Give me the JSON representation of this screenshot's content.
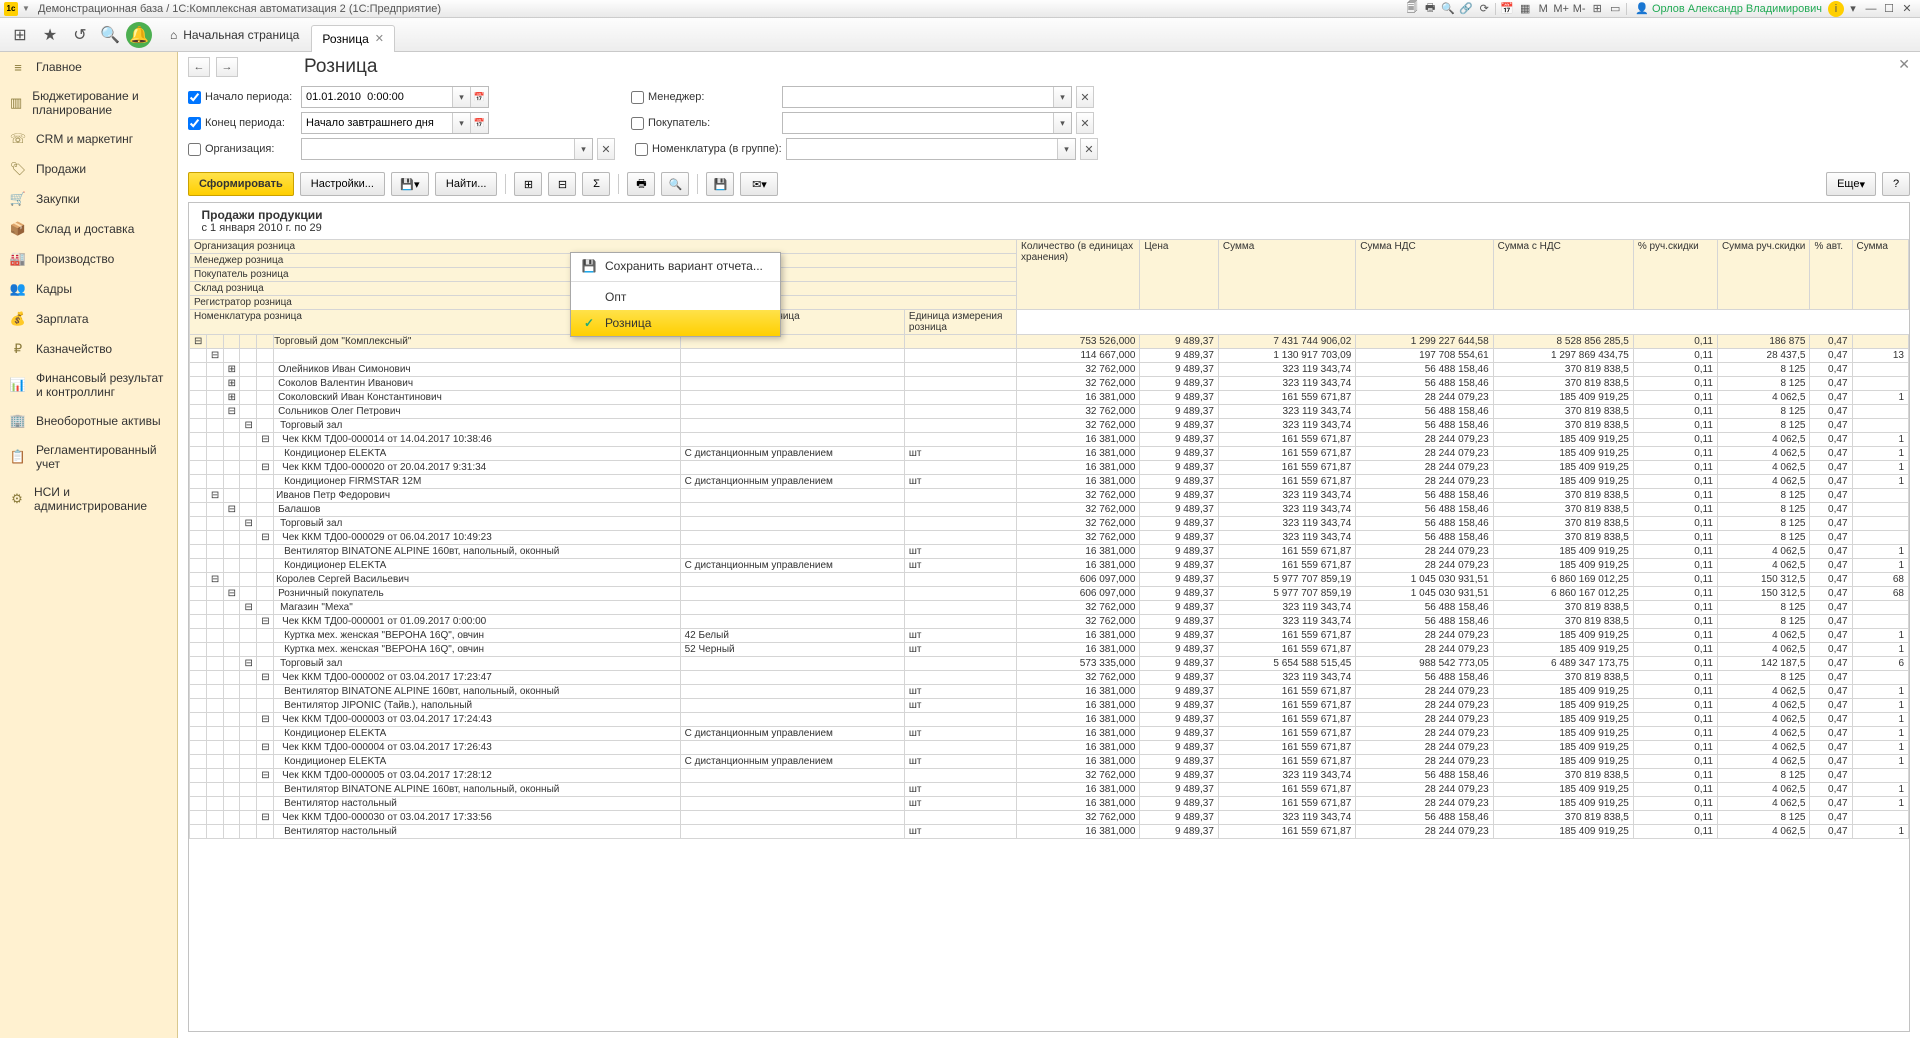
{
  "window": {
    "title": "Демонстрационная база / 1С:Комплексная автоматизация 2  (1С:Предприятие)",
    "user": "Орлов Александр Владимирович"
  },
  "toolbar": {
    "home_label": "Начальная страница",
    "tab_label": "Розница"
  },
  "sidebar": [
    "Главное",
    "Бюджетирование и планирование",
    "CRM и маркетинг",
    "Продажи",
    "Закупки",
    "Склад и доставка",
    "Производство",
    "Кадры",
    "Зарплата",
    "Казначейство",
    "Финансовый результат и контроллинг",
    "Внеоборотные активы",
    "Регламентированный учет",
    "НСИ и администрирование"
  ],
  "page": {
    "title": "Розница"
  },
  "filters": {
    "period_start_label": "Начало периода:",
    "period_start_value": "01.01.2010  0:00:00",
    "period_end_label": "Конец периода:",
    "period_end_value": "Начало завтрашнего дня",
    "org_label": "Организация:",
    "manager_label": "Менеджер:",
    "buyer_label": "Покупатель:",
    "nomenclature_label": "Номенклатура (в группе):"
  },
  "actions": {
    "generate": "Сформировать",
    "settings": "Настройки...",
    "find": "Найти...",
    "more": "Еще"
  },
  "dropdown": {
    "save_variant": "Сохранить вариант отчета...",
    "opt_wholesale": "Опт",
    "opt_retail": "Розница"
  },
  "report": {
    "title": "Продажи продукции",
    "subtitle": "с 1 января 2010 г. по 29",
    "header_rows": [
      "Организация розница",
      "Менеджер розница",
      "Покупатель розница",
      "Склад розница",
      "Регистратор розница"
    ],
    "header_nomen": "Номенклатура розница",
    "header_char": "Характеристика розница",
    "header_unit": "Единица измерения розница",
    "cols": [
      "Количество (в единицах хранения)",
      "Цена",
      "Сумма",
      "Сумма НДС",
      "Сумма с НДС",
      "% руч.скидки",
      "Сумма руч.скидки",
      "% авт.",
      "Сумма"
    ]
  },
  "rows": [
    {
      "ind": 0,
      "exp": "-",
      "name": "Торговый дом \"Комплексный\"",
      "v": [
        "753 526,000",
        "9 489,37",
        "7 431 744 906,02",
        "1 299 227 644,58",
        "8 528 856 285,5",
        "0,11",
        "186 875",
        "0,47",
        ""
      ]
    },
    {
      "ind": 1,
      "exp": "-",
      "name": "",
      "v": [
        "114 667,000",
        "9 489,37",
        "1 130 917 703,09",
        "197 708 554,61",
        "1 297 869 434,75",
        "0,11",
        "28 437,5",
        "0,47",
        "13"
      ]
    },
    {
      "ind": 2,
      "exp": "+",
      "name": "Олейников Иван Симонович",
      "v": [
        "32 762,000",
        "9 489,37",
        "323 119 343,74",
        "56 488 158,46",
        "370 819 838,5",
        "0,11",
        "8 125",
        "0,47",
        ""
      ]
    },
    {
      "ind": 2,
      "exp": "+",
      "name": "Соколов Валентин Иванович",
      "v": [
        "32 762,000",
        "9 489,37",
        "323 119 343,74",
        "56 488 158,46",
        "370 819 838,5",
        "0,11",
        "8 125",
        "0,47",
        ""
      ]
    },
    {
      "ind": 2,
      "exp": "+",
      "name": "Соколовский Иван Константинович",
      "v": [
        "16 381,000",
        "9 489,37",
        "161 559 671,87",
        "28 244 079,23",
        "185 409 919,25",
        "0,11",
        "4 062,5",
        "0,47",
        "1"
      ]
    },
    {
      "ind": 2,
      "exp": "-",
      "name": "Сольников Олег Петрович",
      "v": [
        "32 762,000",
        "9 489,37",
        "323 119 343,74",
        "56 488 158,46",
        "370 819 838,5",
        "0,11",
        "8 125",
        "0,47",
        ""
      ]
    },
    {
      "ind": 3,
      "exp": "-",
      "name": "Торговый зал",
      "v": [
        "32 762,000",
        "9 489,37",
        "323 119 343,74",
        "56 488 158,46",
        "370 819 838,5",
        "0,11",
        "8 125",
        "0,47",
        ""
      ]
    },
    {
      "ind": 4,
      "exp": "-",
      "name": "Чек ККМ ТД00-000014 от 14.04.2017 10:38:46",
      "v": [
        "16 381,000",
        "9 489,37",
        "161 559 671,87",
        "28 244 079,23",
        "185 409 919,25",
        "0,11",
        "4 062,5",
        "0,47",
        "1"
      ]
    },
    {
      "ind": 5,
      "exp": "",
      "name": "Кондиционер ELEKTA",
      "char": "С дистанционным управлением",
      "unit": "шт",
      "v": [
        "16 381,000",
        "9 489,37",
        "161 559 671,87",
        "28 244 079,23",
        "185 409 919,25",
        "0,11",
        "4 062,5",
        "0,47",
        "1"
      ]
    },
    {
      "ind": 4,
      "exp": "-",
      "name": "Чек ККМ ТД00-000020 от 20.04.2017 9:31:34",
      "v": [
        "16 381,000",
        "9 489,37",
        "161 559 671,87",
        "28 244 079,23",
        "185 409 919,25",
        "0,11",
        "4 062,5",
        "0,47",
        "1"
      ]
    },
    {
      "ind": 5,
      "exp": "",
      "name": "Кондиционер FIRMSTAR 12M",
      "char": "С дистанционным управлением",
      "unit": "шт",
      "v": [
        "16 381,000",
        "9 489,37",
        "161 559 671,87",
        "28 244 079,23",
        "185 409 919,25",
        "0,11",
        "4 062,5",
        "0,47",
        "1"
      ]
    },
    {
      "ind": 1,
      "exp": "-",
      "name": "Иванов Петр Федорович",
      "v": [
        "32 762,000",
        "9 489,37",
        "323 119 343,74",
        "56 488 158,46",
        "370 819 838,5",
        "0,11",
        "8 125",
        "0,47",
        ""
      ]
    },
    {
      "ind": 2,
      "exp": "-",
      "name": "Балашов",
      "v": [
        "32 762,000",
        "9 489,37",
        "323 119 343,74",
        "56 488 158,46",
        "370 819 838,5",
        "0,11",
        "8 125",
        "0,47",
        ""
      ]
    },
    {
      "ind": 3,
      "exp": "-",
      "name": "Торговый зал",
      "v": [
        "32 762,000",
        "9 489,37",
        "323 119 343,74",
        "56 488 158,46",
        "370 819 838,5",
        "0,11",
        "8 125",
        "0,47",
        ""
      ]
    },
    {
      "ind": 4,
      "exp": "-",
      "name": "Чек ККМ ТД00-000029 от 06.04.2017 10:49:23",
      "v": [
        "32 762,000",
        "9 489,37",
        "323 119 343,74",
        "56 488 158,46",
        "370 819 838,5",
        "0,11",
        "8 125",
        "0,47",
        ""
      ]
    },
    {
      "ind": 5,
      "exp": "",
      "name": "Вентилятор BINATONE ALPINE 160вт, напольный, оконный",
      "unit": "шт",
      "v": [
        "16 381,000",
        "9 489,37",
        "161 559 671,87",
        "28 244 079,23",
        "185 409 919,25",
        "0,11",
        "4 062,5",
        "0,47",
        "1"
      ]
    },
    {
      "ind": 5,
      "exp": "",
      "name": "Кондиционер ELEKTA",
      "char": "С дистанционным управлением",
      "unit": "шт",
      "v": [
        "16 381,000",
        "9 489,37",
        "161 559 671,87",
        "28 244 079,23",
        "185 409 919,25",
        "0,11",
        "4 062,5",
        "0,47",
        "1"
      ]
    },
    {
      "ind": 1,
      "exp": "-",
      "name": "Королев Сергей Васильевич",
      "v": [
        "606 097,000",
        "9 489,37",
        "5 977 707 859,19",
        "1 045 030 931,51",
        "6 860 169 012,25",
        "0,11",
        "150 312,5",
        "0,47",
        "68"
      ]
    },
    {
      "ind": 2,
      "exp": "-",
      "name": "Розничный покупатель",
      "v": [
        "606 097,000",
        "9 489,37",
        "5 977 707 859,19",
        "1 045 030 931,51",
        "6 860 167 012,25",
        "0,11",
        "150 312,5",
        "0,47",
        "68"
      ]
    },
    {
      "ind": 3,
      "exp": "-",
      "name": "Магазин \"Меха\"",
      "v": [
        "32 762,000",
        "9 489,37",
        "323 119 343,74",
        "56 488 158,46",
        "370 819 838,5",
        "0,11",
        "8 125",
        "0,47",
        ""
      ]
    },
    {
      "ind": 4,
      "exp": "-",
      "name": "Чек ККМ ТД00-000001 от 01.09.2017 0:00:00",
      "v": [
        "32 762,000",
        "9 489,37",
        "323 119 343,74",
        "56 488 158,46",
        "370 819 838,5",
        "0,11",
        "8 125",
        "0,47",
        ""
      ]
    },
    {
      "ind": 5,
      "exp": "",
      "name": "Куртка мех. женская \"ВЕРОНА 16Q\", овчин",
      "char": "42 Белый",
      "unit": "шт",
      "v": [
        "16 381,000",
        "9 489,37",
        "161 559 671,87",
        "28 244 079,23",
        "185 409 919,25",
        "0,11",
        "4 062,5",
        "0,47",
        "1"
      ]
    },
    {
      "ind": 5,
      "exp": "",
      "name": "Куртка мех. женская \"ВЕРОНА 16Q\", овчин",
      "char": "52 Черный",
      "unit": "шт",
      "v": [
        "16 381,000",
        "9 489,37",
        "161 559 671,87",
        "28 244 079,23",
        "185 409 919,25",
        "0,11",
        "4 062,5",
        "0,47",
        "1"
      ]
    },
    {
      "ind": 3,
      "exp": "-",
      "name": "Торговый зал",
      "v": [
        "573 335,000",
        "9 489,37",
        "5 654 588 515,45",
        "988 542 773,05",
        "6 489 347 173,75",
        "0,11",
        "142 187,5",
        "0,47",
        "6"
      ]
    },
    {
      "ind": 4,
      "exp": "-",
      "name": "Чек ККМ ТД00-000002 от 03.04.2017 17:23:47",
      "v": [
        "32 762,000",
        "9 489,37",
        "323 119 343,74",
        "56 488 158,46",
        "370 819 838,5",
        "0,11",
        "8 125",
        "0,47",
        ""
      ]
    },
    {
      "ind": 5,
      "exp": "",
      "name": "Вентилятор BINATONE ALPINE 160вт, напольный, оконный",
      "unit": "шт",
      "v": [
        "16 381,000",
        "9 489,37",
        "161 559 671,87",
        "28 244 079,23",
        "185 409 919,25",
        "0,11",
        "4 062,5",
        "0,47",
        "1"
      ]
    },
    {
      "ind": 5,
      "exp": "",
      "name": "Вентилятор JIPONIC (Тайв.), напольный",
      "unit": "шт",
      "v": [
        "16 381,000",
        "9 489,37",
        "161 559 671,87",
        "28 244 079,23",
        "185 409 919,25",
        "0,11",
        "4 062,5",
        "0,47",
        "1"
      ]
    },
    {
      "ind": 4,
      "exp": "-",
      "name": "Чек ККМ ТД00-000003 от 03.04.2017 17:24:43",
      "v": [
        "16 381,000",
        "9 489,37",
        "161 559 671,87",
        "28 244 079,23",
        "185 409 919,25",
        "0,11",
        "4 062,5",
        "0,47",
        "1"
      ]
    },
    {
      "ind": 5,
      "exp": "",
      "name": "Кондиционер ELEKTA",
      "char": "С дистанционным управлением",
      "unit": "шт",
      "v": [
        "16 381,000",
        "9 489,37",
        "161 559 671,87",
        "28 244 079,23",
        "185 409 919,25",
        "0,11",
        "4 062,5",
        "0,47",
        "1"
      ]
    },
    {
      "ind": 4,
      "exp": "-",
      "name": "Чек ККМ ТД00-000004 от 03.04.2017 17:26:43",
      "v": [
        "16 381,000",
        "9 489,37",
        "161 559 671,87",
        "28 244 079,23",
        "185 409 919,25",
        "0,11",
        "4 062,5",
        "0,47",
        "1"
      ]
    },
    {
      "ind": 5,
      "exp": "",
      "name": "Кондиционер ELEKTA",
      "char": "С дистанционным управлением",
      "unit": "шт",
      "v": [
        "16 381,000",
        "9 489,37",
        "161 559 671,87",
        "28 244 079,23",
        "185 409 919,25",
        "0,11",
        "4 062,5",
        "0,47",
        "1"
      ]
    },
    {
      "ind": 4,
      "exp": "-",
      "name": "Чек ККМ ТД00-000005 от 03.04.2017 17:28:12",
      "v": [
        "32 762,000",
        "9 489,37",
        "323 119 343,74",
        "56 488 158,46",
        "370 819 838,5",
        "0,11",
        "8 125",
        "0,47",
        ""
      ]
    },
    {
      "ind": 5,
      "exp": "",
      "name": "Вентилятор BINATONE ALPINE 160вт, напольный, оконный",
      "unit": "шт",
      "v": [
        "16 381,000",
        "9 489,37",
        "161 559 671,87",
        "28 244 079,23",
        "185 409 919,25",
        "0,11",
        "4 062,5",
        "0,47",
        "1"
      ]
    },
    {
      "ind": 5,
      "exp": "",
      "name": "Вентилятор настольный",
      "unit": "шт",
      "v": [
        "16 381,000",
        "9 489,37",
        "161 559 671,87",
        "28 244 079,23",
        "185 409 919,25",
        "0,11",
        "4 062,5",
        "0,47",
        "1"
      ]
    },
    {
      "ind": 4,
      "exp": "-",
      "name": "Чек ККМ ТД00-000030 от 03.04.2017 17:33:56",
      "v": [
        "32 762,000",
        "9 489,37",
        "323 119 343,74",
        "56 488 158,46",
        "370 819 838,5",
        "0,11",
        "8 125",
        "0,47",
        ""
      ]
    },
    {
      "ind": 5,
      "exp": "",
      "name": "Вентилятор настольный",
      "unit": "шт",
      "v": [
        "16 381,000",
        "9 489,37",
        "161 559 671,87",
        "28 244 079,23",
        "185 409 919,25",
        "0,11",
        "4 062,5",
        "0,47",
        "1"
      ]
    }
  ]
}
